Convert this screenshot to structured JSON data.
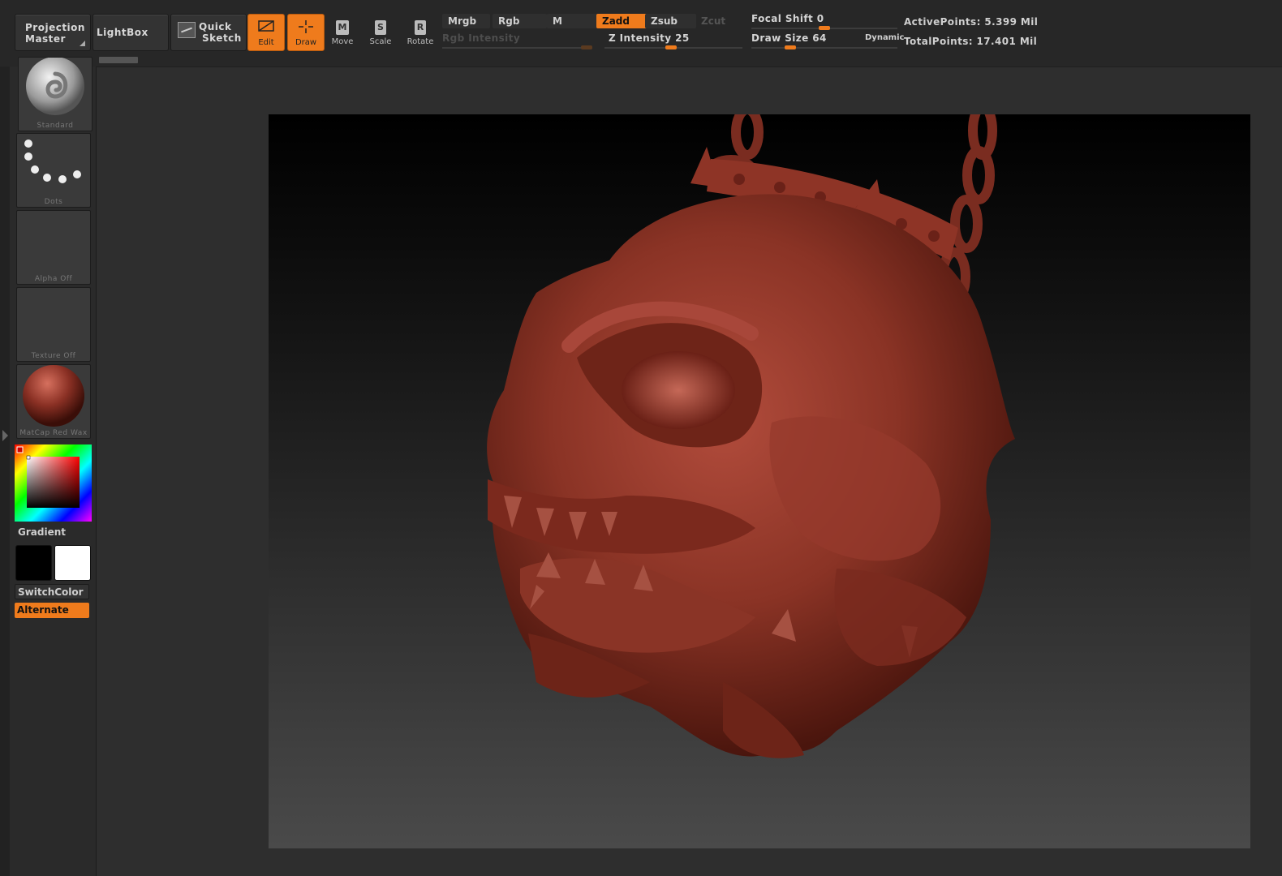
{
  "toolbar": {
    "projection_master": [
      "Projection",
      "Master"
    ],
    "lightbox": "LightBox",
    "quick_sketch": [
      "Quick",
      "Sketch"
    ],
    "tools": {
      "edit": "Edit",
      "draw": "Draw",
      "move": "Move",
      "scale": "Scale",
      "rotate": "Rotate",
      "move_tag": "M",
      "scale_tag": "S",
      "rotate_tag": "R"
    },
    "modes": {
      "mrgb": "Mrgb",
      "rgb": "Rgb",
      "m": "M",
      "zadd": "Zadd",
      "zsub": "Zsub",
      "zcut": "Zcut"
    },
    "rgb_intensity": "Rgb Intensity",
    "z_intensity": "Z Intensity 25",
    "focal_shift": "Focal Shift 0",
    "draw_size": "Draw Size 64",
    "dynamic": "Dynamic",
    "active_points": "ActivePoints: 5.399 Mil",
    "total_points": "TotalPoints: 17.401 Mil"
  },
  "shelf": {
    "brush": "Standard",
    "stroke": "Dots",
    "alpha": "Alpha Off",
    "texture": "Texture Off",
    "material": "MatCap Red Wax",
    "gradient": "Gradient",
    "switch_color": "SwitchColor",
    "alternate": "Alternate"
  },
  "colors": {
    "accent": "#ef7b1c",
    "material": "#8a3024",
    "main_color": "#000000",
    "secondary_color": "#ffffff"
  }
}
